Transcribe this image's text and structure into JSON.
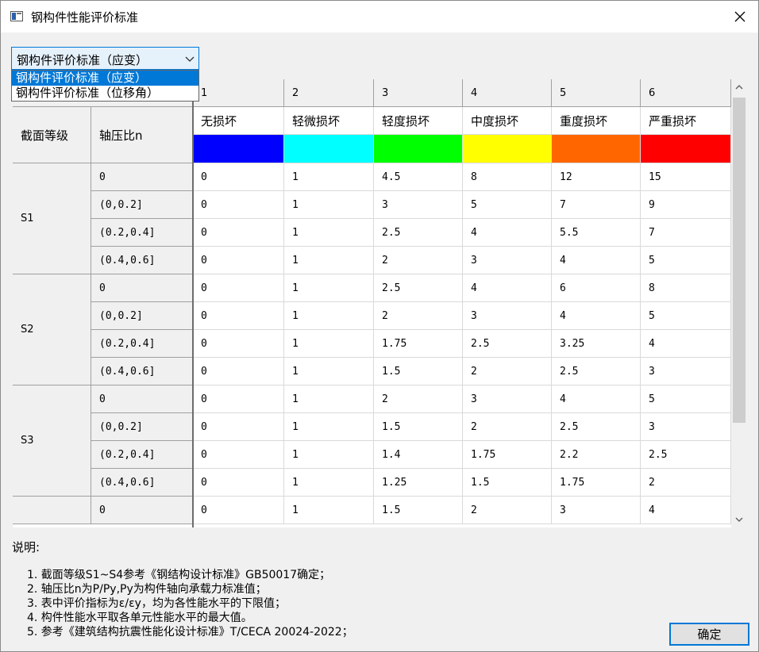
{
  "window": {
    "title": "钢构件性能评价标准",
    "close_glyph": "✕"
  },
  "standard_select": {
    "value": "钢构件评价标准（应变）",
    "options": [
      "钢构件评价标准（应变）",
      "钢构件评价标准（位移角）"
    ]
  },
  "table": {
    "column_numbers": [
      "1",
      "2",
      "3",
      "4",
      "5",
      "6"
    ],
    "section_header": "截面等级",
    "ratio_header": "轴压比n",
    "levels": [
      {
        "name": "无损坏",
        "color": "#0000ff"
      },
      {
        "name": "轻微损坏",
        "color": "#00ffff"
      },
      {
        "name": "轻度损坏",
        "color": "#00ff00"
      },
      {
        "name": "中度损坏",
        "color": "#ffff00"
      },
      {
        "name": "重度损坏",
        "color": "#ff6600"
      },
      {
        "name": "严重损坏",
        "color": "#ff0000"
      }
    ],
    "groups": [
      {
        "name": "S1",
        "rows": [
          {
            "ratio": "0",
            "values": [
              "0",
              "1",
              "4.5",
              "8",
              "12",
              "15"
            ]
          },
          {
            "ratio": "(0,0.2]",
            "values": [
              "0",
              "1",
              "3",
              "5",
              "7",
              "9"
            ]
          },
          {
            "ratio": "(0.2,0.4]",
            "values": [
              "0",
              "1",
              "2.5",
              "4",
              "5.5",
              "7"
            ]
          },
          {
            "ratio": "(0.4,0.6]",
            "values": [
              "0",
              "1",
              "2",
              "3",
              "4",
              "5"
            ]
          }
        ]
      },
      {
        "name": "S2",
        "rows": [
          {
            "ratio": "0",
            "values": [
              "0",
              "1",
              "2.5",
              "4",
              "6",
              "8"
            ]
          },
          {
            "ratio": "(0,0.2]",
            "values": [
              "0",
              "1",
              "2",
              "3",
              "4",
              "5"
            ]
          },
          {
            "ratio": "(0.2,0.4]",
            "values": [
              "0",
              "1",
              "1.75",
              "2.5",
              "3.25",
              "4"
            ]
          },
          {
            "ratio": "(0.4,0.6]",
            "values": [
              "0",
              "1",
              "1.5",
              "2",
              "2.5",
              "3"
            ]
          }
        ]
      },
      {
        "name": "S3",
        "rows": [
          {
            "ratio": "0",
            "values": [
              "0",
              "1",
              "2",
              "3",
              "4",
              "5"
            ]
          },
          {
            "ratio": "(0,0.2]",
            "values": [
              "0",
              "1",
              "1.5",
              "2",
              "2.5",
              "3"
            ]
          },
          {
            "ratio": "(0.2,0.4]",
            "values": [
              "0",
              "1",
              "1.4",
              "1.75",
              "2.2",
              "2.5"
            ]
          },
          {
            "ratio": "(0.4,0.6]",
            "values": [
              "0",
              "1",
              "1.25",
              "1.5",
              "1.75",
              "2"
            ]
          }
        ]
      },
      {
        "name": "",
        "rows": [
          {
            "ratio": "0",
            "values": [
              "0",
              "1",
              "1.5",
              "2",
              "3",
              "4"
            ]
          }
        ]
      }
    ]
  },
  "notes": {
    "label": "说明:",
    "items": [
      "1. 截面等级S1~S4参考《钢结构设计标准》GB50017确定；",
      "2. 轴压比n为P/Py,Py为构件轴向承载力标准值；",
      "3. 表中评价指标为ε/εy，均为各性能水平的下限值；",
      "4. 构件性能水平取各单元性能水平的最大值。",
      "5. 参考《建筑结构抗震性能化设计标准》T/CECA 20024-2022；"
    ]
  },
  "ok_button": {
    "label": "确定"
  }
}
